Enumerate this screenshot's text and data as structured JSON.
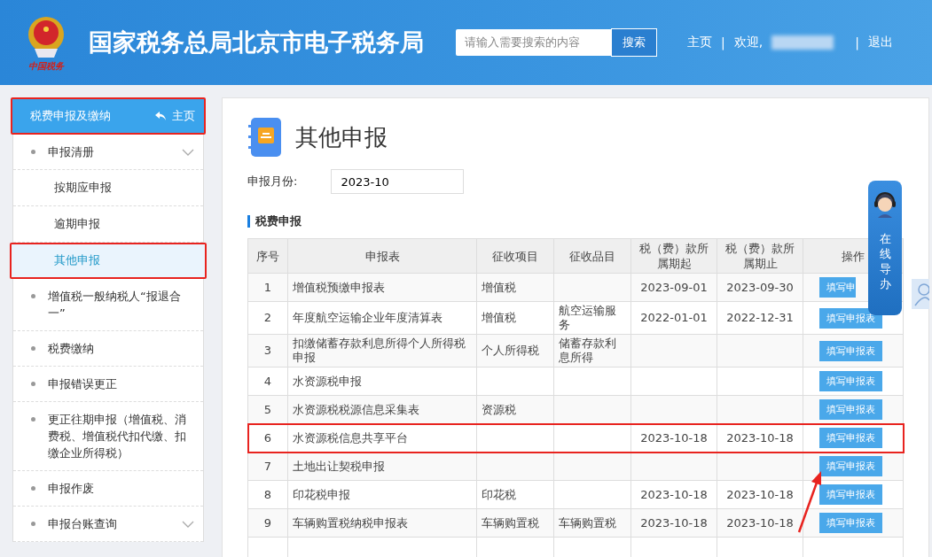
{
  "header": {
    "title": "国家税务总局北京市电子税务局",
    "logo_caption": "中国税务",
    "search": {
      "placeholder": "请输入需要搜索的内容",
      "button": "搜索"
    },
    "nav": [
      {
        "kind": "link",
        "label": "主页"
      },
      {
        "kind": "separator",
        "label": "|"
      },
      {
        "kind": "text",
        "label": "欢迎,"
      },
      {
        "kind": "redacted"
      },
      {
        "kind": "separator",
        "label": "|"
      },
      {
        "kind": "link",
        "label": "退出"
      }
    ]
  },
  "sidebar": {
    "title": "税费申报及缴纳",
    "home_link": "主页",
    "highlighted": true,
    "items": [
      {
        "label": "申报清册",
        "expandable": true,
        "highlighted": false,
        "children": [
          {
            "label": "按期应申报",
            "selected": false,
            "highlighted": false
          },
          {
            "label": "逾期申报",
            "selected": false,
            "highlighted": false
          },
          {
            "label": "其他申报",
            "selected": true,
            "highlighted": true
          }
        ]
      },
      {
        "label": "增值税一般纳税人“报退合一”",
        "expandable": false,
        "highlighted": false
      },
      {
        "label": "税费缴纳",
        "expandable": false,
        "highlighted": false
      },
      {
        "label": "申报错误更正",
        "expandable": false,
        "highlighted": false
      },
      {
        "label": "更正往期申报（增值税、消费税、增值税代扣代缴、扣缴企业所得税）",
        "expandable": false,
        "highlighted": false
      },
      {
        "label": "申报作废",
        "expandable": false,
        "highlighted": false
      },
      {
        "label": "申报台账查询",
        "expandable": true,
        "highlighted": false
      }
    ]
  },
  "page": {
    "title": "其他申报",
    "month_label": "申报月份:",
    "month_value": "2023-10",
    "section_title": "税费申报"
  },
  "table": {
    "columns": [
      "序号",
      "申报表",
      "征收项目",
      "征收品目",
      "税（费）款所属期起",
      "税（费）款所属期止",
      "操作"
    ],
    "rows": [
      {
        "no": "1",
        "form": "增值税预缴申报表",
        "item": "增值税",
        "category": "",
        "start": "2023-09-01",
        "end": "2023-09-30",
        "action": "填写申",
        "action_covered": true,
        "highlighted": false
      },
      {
        "no": "2",
        "form": "年度航空运输企业年度清算表",
        "item": "增值税",
        "category": "航空运输服务",
        "start": "2022-01-01",
        "end": "2022-12-31",
        "action": "填写申报表",
        "action_covered": false,
        "highlighted": false
      },
      {
        "no": "3",
        "form": "扣缴储蓄存款利息所得个人所得税申报",
        "item": "个人所得税",
        "category": "储蓄存款利息所得",
        "start": "",
        "end": "",
        "action": "填写申报表",
        "action_covered": false,
        "highlighted": false
      },
      {
        "no": "4",
        "form": "水资源税申报",
        "item": "",
        "category": "",
        "start": "",
        "end": "",
        "action": "填写申报表",
        "action_covered": false,
        "highlighted": false
      },
      {
        "no": "5",
        "form": "水资源税税源信息采集表",
        "item": "资源税",
        "category": "",
        "start": "",
        "end": "",
        "action": "填写申报表",
        "action_covered": false,
        "highlighted": false
      },
      {
        "no": "6",
        "form": "水资源税信息共享平台",
        "item": "",
        "category": "",
        "start": "2023-10-18",
        "end": "2023-10-18",
        "action": "填写申报表",
        "action_covered": false,
        "highlighted": true
      },
      {
        "no": "7",
        "form": "土地出让契税申报",
        "item": "",
        "category": "",
        "start": "",
        "end": "",
        "action": "填写申报表",
        "action_covered": false,
        "highlighted": false
      },
      {
        "no": "8",
        "form": "印花税申报",
        "item": "印花税",
        "category": "",
        "start": "2023-10-18",
        "end": "2023-10-18",
        "action": "填写申报表",
        "action_covered": false,
        "highlighted": false
      },
      {
        "no": "9",
        "form": "车辆购置税纳税申报表",
        "item": "车辆购置税",
        "category": "车辆购置税",
        "start": "2023-10-18",
        "end": "2023-10-18",
        "action": "填写申报表",
        "action_covered": false,
        "highlighted": false
      }
    ]
  },
  "annotation": {
    "kind": "arrow"
  },
  "assistant": {
    "label": "在线导办"
  }
}
